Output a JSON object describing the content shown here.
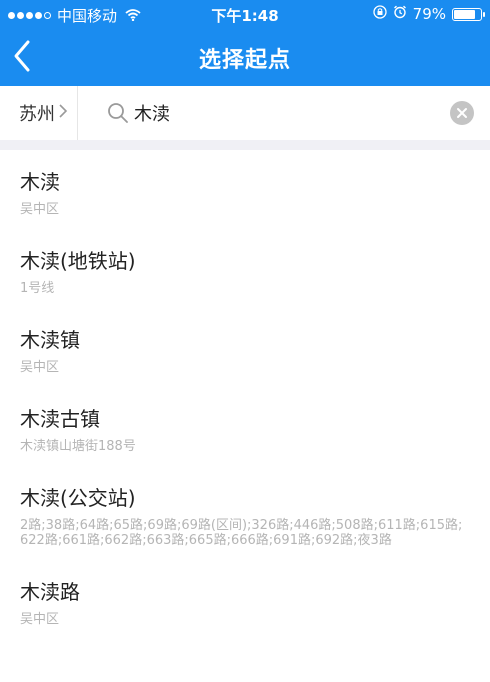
{
  "status_bar": {
    "carrier": "中国移动",
    "time": "下午1:48",
    "battery_text": "79%",
    "battery_level": 0.79
  },
  "nav": {
    "title": "选择起点",
    "back_icon": "chevron-left-icon"
  },
  "search": {
    "city": "苏州",
    "query": "木渎"
  },
  "results": [
    {
      "title": "木渎",
      "subtitle": "吴中区"
    },
    {
      "title": "木渎(地铁站)",
      "subtitle": "1号线"
    },
    {
      "title": "木渎镇",
      "subtitle": "吴中区"
    },
    {
      "title": "木渎古镇",
      "subtitle": "木渎镇山塘街188号"
    },
    {
      "title": "木渎(公交站)",
      "subtitle": "2路;38路;64路;65路;69路;69路(区间);326路;446路;508路;611路;615路;622路;661路;662路;663路;665路;666路;691路;692路;夜3路"
    },
    {
      "title": "木渎路",
      "subtitle": "吴中区"
    }
  ],
  "colors": {
    "header_bg": "#1a8cf0",
    "separator_bg": "#f0f0f5"
  }
}
